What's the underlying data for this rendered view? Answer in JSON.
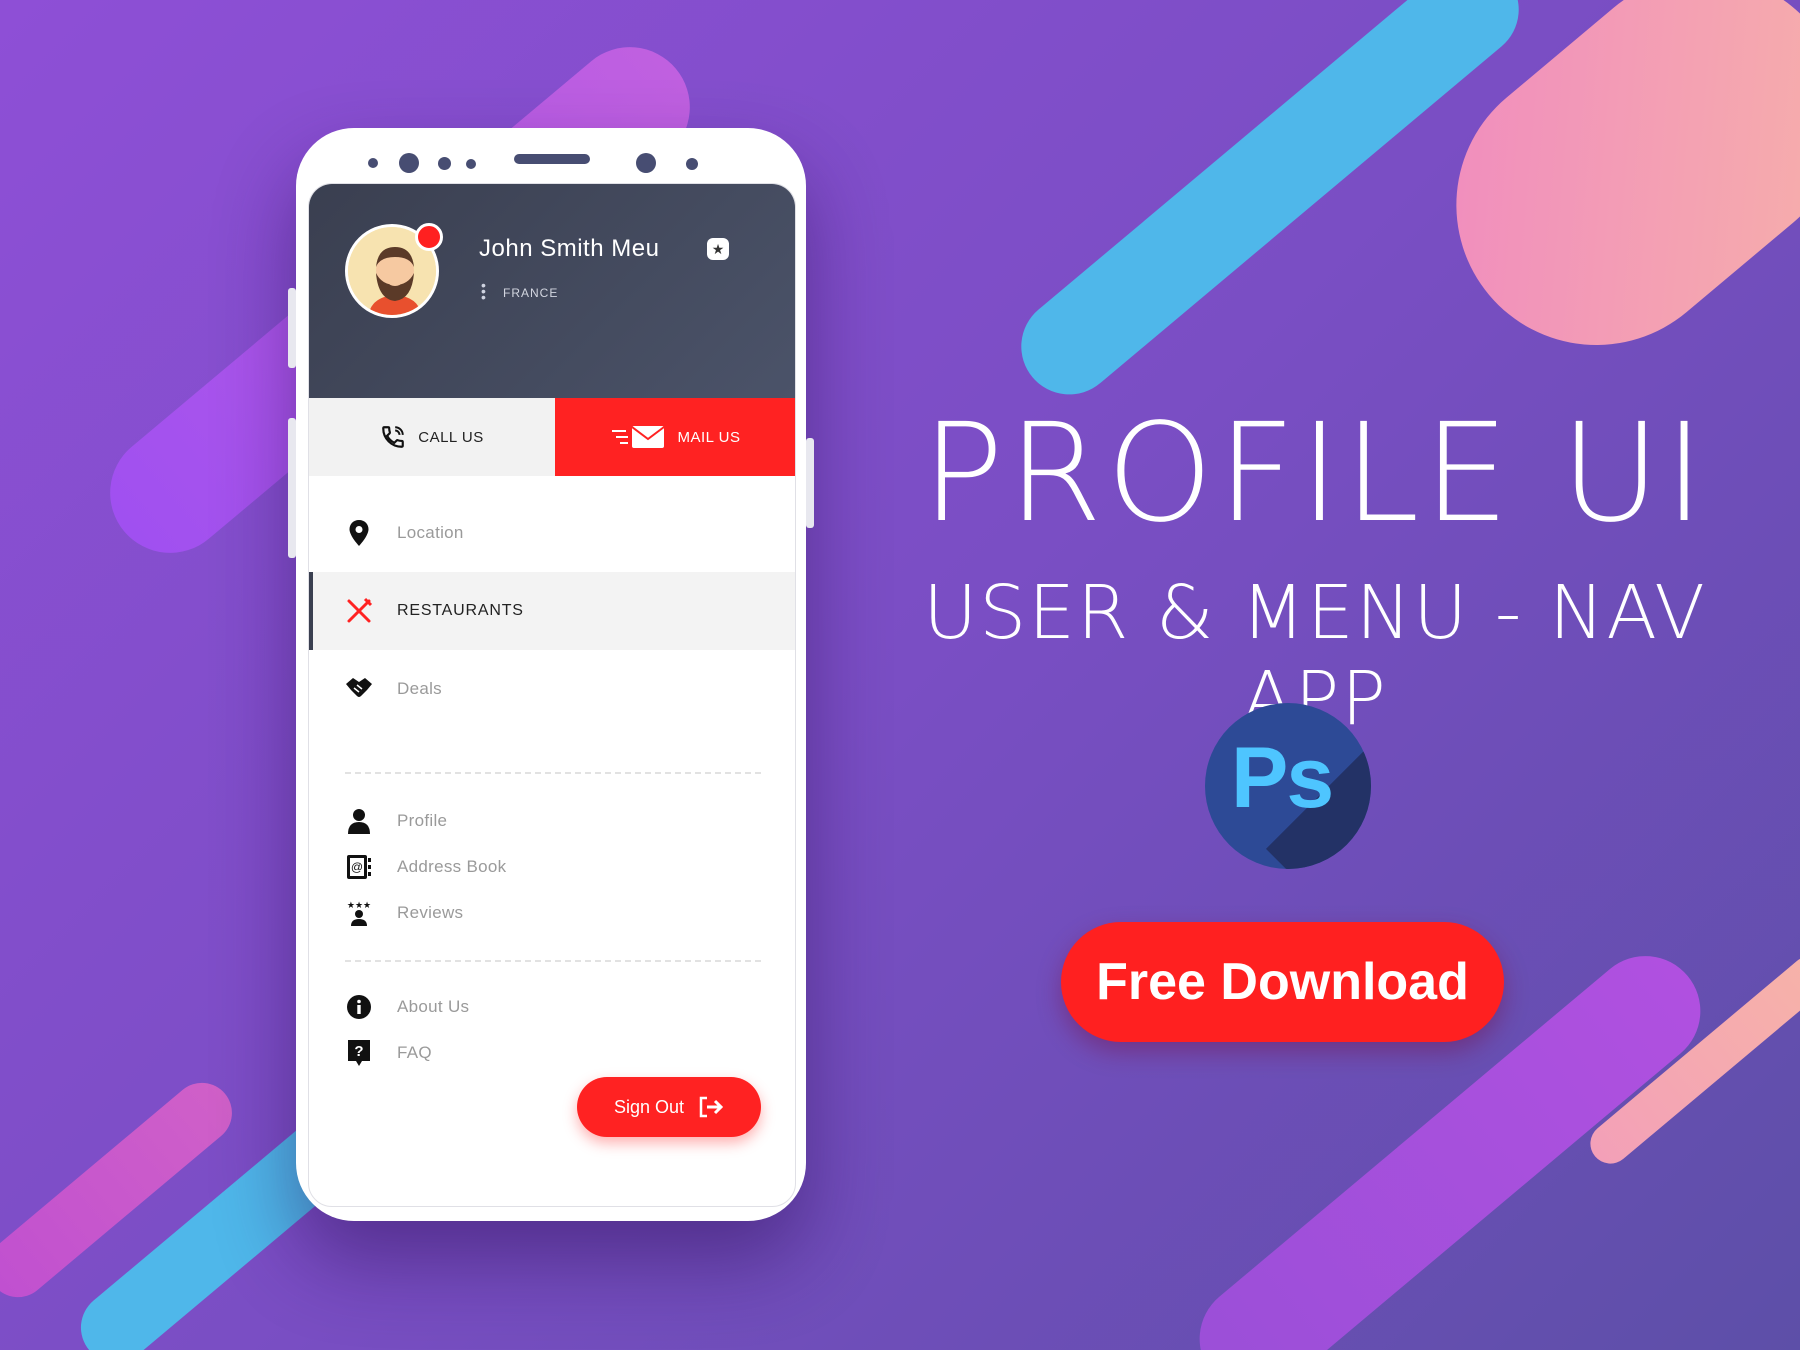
{
  "colors": {
    "accent": "#ff2222",
    "header": "#3a3f50",
    "ps_blue": "#4ec5ff"
  },
  "profile": {
    "name": "John Smith Meu",
    "country": "FRANCE",
    "badge_icon": "star-icon",
    "notification_icon": "notification-dot"
  },
  "actions": {
    "call_label": "CALL US",
    "mail_label": "MAIL US"
  },
  "menu": {
    "main": [
      {
        "label": "Location",
        "icon": "location-pin-icon"
      },
      {
        "label": "RESTAURANTS",
        "icon": "fork-knife-icon",
        "active": true
      },
      {
        "label": "Deals",
        "icon": "handshake-icon"
      }
    ],
    "account": [
      {
        "label": "Profile",
        "icon": "user-icon"
      },
      {
        "label": "Address Book",
        "icon": "address-book-icon"
      },
      {
        "label": "Reviews",
        "icon": "reviews-icon"
      }
    ],
    "info": [
      {
        "label": "About Us",
        "icon": "info-icon"
      },
      {
        "label": "FAQ",
        "icon": "faq-icon"
      }
    ]
  },
  "signout_label": "Sign Out",
  "promo": {
    "title": "PROFILE UI",
    "subtitle": "USER & MENU - NAV APP",
    "ps_logo": "Ps",
    "download_label": "Free Download"
  }
}
